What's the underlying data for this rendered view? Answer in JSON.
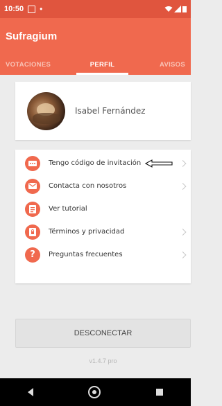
{
  "status_bar": {
    "time": "10:50",
    "dot": "•"
  },
  "app_bar": {
    "title": "Sufragium"
  },
  "tabs": [
    {
      "label": "VOTACIONES",
      "active": false
    },
    {
      "label": "PERFIL",
      "active": true
    },
    {
      "label": "AVISOS",
      "active": false
    }
  ],
  "profile": {
    "name": "Isabel Fernández"
  },
  "menu": {
    "items": [
      {
        "label": "Tengo código de invitación",
        "icon": "ticket-icon",
        "glyph": "▬"
      },
      {
        "label": "Contacta con nosotros",
        "icon": "mail-icon",
        "glyph": "✉"
      },
      {
        "label": "Ver tutorial",
        "icon": "document-icon",
        "glyph": "▤"
      },
      {
        "label": "Términos y privacidad",
        "icon": "lock-icon",
        "glyph": "▣"
      },
      {
        "label": "Preguntas frecuentes",
        "icon": "question-icon",
        "glyph": "?"
      }
    ]
  },
  "logout": {
    "label": "DESCONECTAR"
  },
  "version": "v1.4.7 pro",
  "colors": {
    "accent": "#f0694e",
    "statusbar": "#e0553e"
  }
}
